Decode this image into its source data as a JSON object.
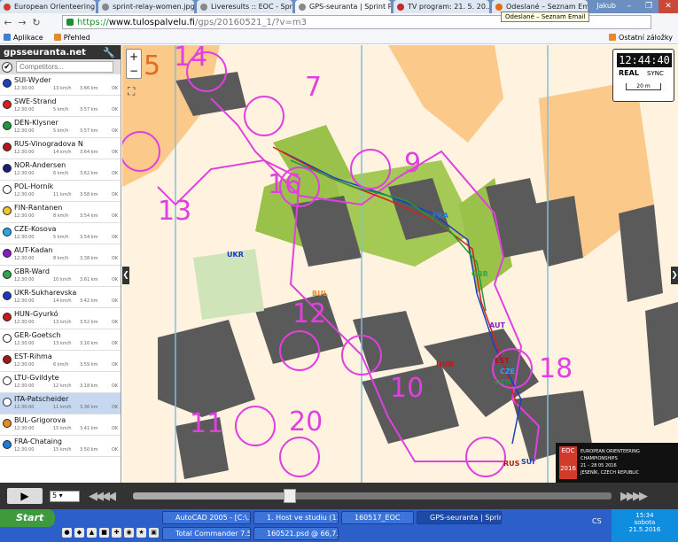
{
  "browser": {
    "tabs": [
      {
        "title": "European Orienteering Cl...",
        "color": "#d23a2c"
      },
      {
        "title": "sprint-relay-women.jpg (...",
        "color": "#888888"
      },
      {
        "title": "Liveresults :: EOC - Sprin...",
        "color": "#888888"
      },
      {
        "title": "GPS-seuranta | Sprint Re...",
        "color": "#888888",
        "active": true
      },
      {
        "title": "TV program: 21. 5. 20...",
        "color": "#c8282a"
      },
      {
        "title": "Odeslané – Seznam Email",
        "color": "#e36b1e"
      }
    ],
    "user": "Jakub",
    "tooltip": "Odeslané – Seznam Email",
    "url": {
      "scheme": "https://",
      "host": "www.tulospalvelu.fi",
      "path": "/gps/20160521_1/?v=m3"
    },
    "bookmarks": {
      "apps": "Aplikace",
      "overview": "Přehled",
      "other": "Ostatní záložky"
    }
  },
  "panel": {
    "title": "gpsseuranta.net",
    "search_placeholder": "Competitors...",
    "competitors": [
      {
        "name": "SUI-Wyder",
        "time": "12:30:00",
        "speed": "13 km/h",
        "dist": "3.66 km",
        "status": "OK",
        "color": "#1c3fc0"
      },
      {
        "name": "SWE-Strand",
        "time": "12:30:00",
        "speed": "5 km/h",
        "dist": "3.57 km",
        "status": "OK",
        "color": "#d62020"
      },
      {
        "name": "DEN-Klysner",
        "time": "12:30:00",
        "speed": "5 km/h",
        "dist": "3.57 km",
        "status": "OK",
        "color": "#1a9a3a"
      },
      {
        "name": "RUS-Vinogradova N",
        "time": "12:30:00",
        "speed": "14 km/h",
        "dist": "3.64 km",
        "status": "OK",
        "color": "#b01818"
      },
      {
        "name": "NOR-Andersen",
        "time": "12:30:00",
        "speed": "6 km/h",
        "dist": "3.62 km",
        "status": "OK",
        "color": "#14207a"
      },
      {
        "name": "POL-Hornik",
        "time": "12:30:00",
        "speed": "11 km/h",
        "dist": "3.58 km",
        "status": "OK",
        "color": "#ffffff"
      },
      {
        "name": "FIN-Rantanen",
        "time": "12:30:00",
        "speed": "8 km/h",
        "dist": "3.54 km",
        "status": "OK",
        "color": "#f2c230"
      },
      {
        "name": "CZE-Kosova",
        "time": "12:30:00",
        "speed": "5 km/h",
        "dist": "3.54 km",
        "status": "OK",
        "color": "#2aa6e6"
      },
      {
        "name": "AUT-Kadan",
        "time": "12:30:00",
        "speed": "8 km/h",
        "dist": "3.38 km",
        "status": "OK",
        "color": "#8a1ac8"
      },
      {
        "name": "GBR-Ward",
        "time": "12:30:00",
        "speed": "10 km/h",
        "dist": "3.61 km",
        "status": "OK",
        "color": "#2ea84a"
      },
      {
        "name": "UKR-Sukharevska",
        "time": "12:30:00",
        "speed": "14 km/h",
        "dist": "3.42 km",
        "status": "OK",
        "color": "#1a38c8"
      },
      {
        "name": "HUN-Gyurkó",
        "time": "12:30:00",
        "speed": "13 km/h",
        "dist": "3.52 km",
        "status": "OK",
        "color": "#c81818"
      },
      {
        "name": "GER-Goetsch",
        "time": "12:30:00",
        "speed": "13 km/h",
        "dist": "3.16 km",
        "status": "OK",
        "color": "#ffffff"
      },
      {
        "name": "EST-Rihma",
        "time": "12:30:00",
        "speed": "6 km/h",
        "dist": "3.59 km",
        "status": "OK",
        "color": "#a01818"
      },
      {
        "name": "LTU-Gvildyte",
        "time": "12:30:00",
        "speed": "12 km/h",
        "dist": "3.18 km",
        "status": "OK",
        "color": "#ffffff"
      },
      {
        "name": "ITA-Patscheider",
        "time": "12:30:00",
        "speed": "11 km/h",
        "dist": "3.36 km",
        "status": "OK",
        "color": "#ffffff",
        "selected": true
      },
      {
        "name": "BUL-Grigorova",
        "time": "12:30:00",
        "speed": "15 km/h",
        "dist": "3.41 km",
        "status": "OK",
        "color": "#e88c1e"
      },
      {
        "name": "FRA-Chataing",
        "time": "12:30:00",
        "speed": "15 km/h",
        "dist": "3.50 km",
        "status": "OK",
        "color": "#1e7ad8"
      }
    ]
  },
  "map": {
    "clock": "12:44:40",
    "real": "REAL",
    "sync": "SYNC",
    "scale": "20 m",
    "eoc": {
      "logo": "EOC",
      "year": "2016",
      "line1": "EUROPEAN ORIENTEERING CHAMPIONSHIPS",
      "line2": "21 – 28 05 2016",
      "line3": "JESENÍK, CZECH REPUBLIC"
    },
    "controls": [
      "5",
      "14",
      "7",
      "9",
      "16",
      "13",
      "12",
      "10",
      "11",
      "20",
      "18"
    ],
    "runners": [
      "FRA",
      "UKR",
      "GBR",
      "BUL",
      "AUT",
      "HUN",
      "EST",
      "CZE",
      "DEN",
      "RUS",
      "SUI"
    ]
  },
  "player": {
    "speed": "5",
    "progress": 0.33
  },
  "taskbar": {
    "start": "Start",
    "tasks": [
      "AutoCAD 2005 - [C:\\...",
      "1. Host ve studiu (13...",
      "160517_EOC",
      "GPS-seuranta | Sprint...",
      "Total Commander 7.5...",
      "160521.psd @ 66,7..."
    ],
    "lang": "CS",
    "time": "15:34",
    "day": "sobota",
    "date": "21.5.2016"
  }
}
